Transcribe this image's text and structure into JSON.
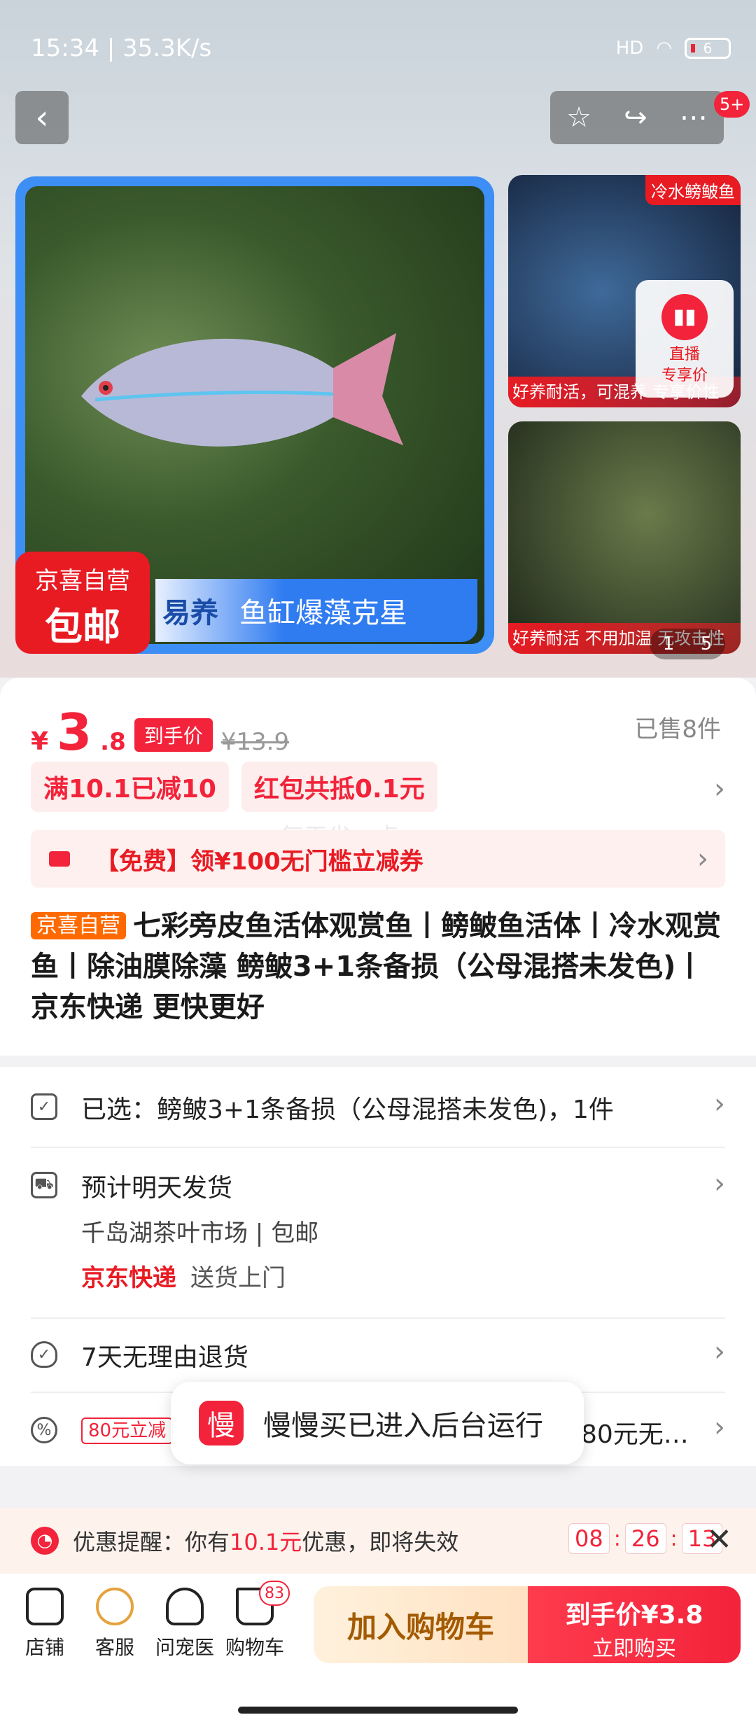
{
  "status": {
    "time_net": "15:34 | 35.3K/s",
    "signal": "HD",
    "battery": "6"
  },
  "header": {
    "message_badge": "5+"
  },
  "gallery": {
    "main_badge_line1": "京喜自营",
    "main_badge_line2": "包邮",
    "main_banner_left": "易养",
    "main_banner_right": "鱼缸爆藻克星",
    "thumb1_tag": "冷水鳑鲏鱼",
    "thumb1_caption": "好养耐活，可混养 专享价性",
    "thumb2_caption": "好养耐活 不用加温 无攻击性",
    "live_label1": "直播",
    "live_label2": "专享价",
    "counter_current": "1",
    "counter_total": "5"
  },
  "price": {
    "currency": "¥",
    "integer": "3",
    "decimal": ".8",
    "final_tag": "到手价",
    "original": "¥13.9",
    "sold": "已售8件"
  },
  "promos": [
    "满10.1已减10",
    "红包共抵0.1元"
  ],
  "coupon": {
    "text": "【免费】领¥100无门槛立减券"
  },
  "watermark": "每天省一点",
  "title": {
    "tag": "京喜自营",
    "text": "七彩旁皮鱼活体观赏鱼丨鳑鲏鱼活体丨冷水观赏鱼丨除油膜除藻 鳑鲏3+1条备损（公母混搭未发色)丨京东快递 更快更好"
  },
  "info": {
    "selected": "已选：鳑鲏3+1条备损（公母混搭未发色)，1件",
    "ship_title": "预计明天发货",
    "ship_origin": "千岛湖茶叶市场",
    "ship_free": "包邮",
    "express": "京东快递",
    "express_sub": "送货上门",
    "return_policy": "7天无理由退货",
    "coupon_tag": "80元立减",
    "coupon_tail": "80元无…"
  },
  "toast": {
    "logo": "慢",
    "text": "慢慢买已进入后台运行"
  },
  "reminder": {
    "prefix": "优惠提醒：你有",
    "amount": "10.1元",
    "suffix": "优惠，即将失效",
    "hh": "08",
    "mm": "26",
    "ss": "13"
  },
  "bottom": {
    "shop": "店铺",
    "service": "客服",
    "vet": "问宠医",
    "cart": "购物车",
    "cart_count": "83",
    "add_cart": "加入购物车",
    "buy_line1": "到手价¥3.8",
    "buy_line2": "立即购买"
  },
  "colors": {
    "accent": "#f2233a",
    "blue_frame": "#3d8ef5",
    "orange_tag": "#ff6a00"
  },
  "icons": [
    "back-icon",
    "star-icon",
    "share-icon",
    "more-icon",
    "live-icon",
    "coupon-icon",
    "checklist-icon",
    "truck-icon",
    "shield-icon",
    "badge-icon",
    "clock-icon",
    "close-icon",
    "shop-icon",
    "service-icon",
    "vet-icon",
    "cart-icon"
  ]
}
